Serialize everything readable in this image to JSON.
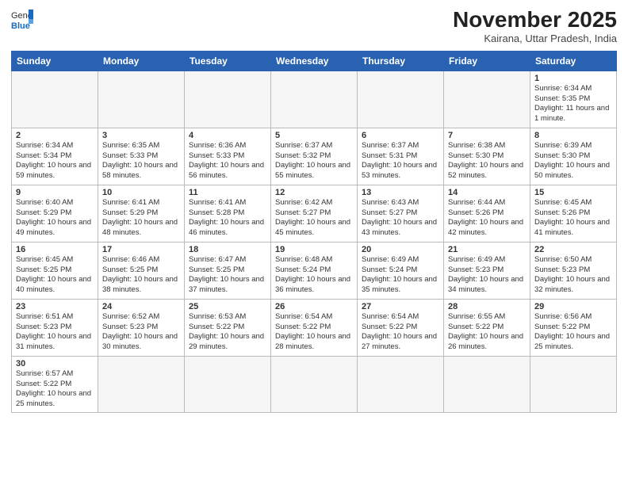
{
  "header": {
    "logo_general": "General",
    "logo_blue": "Blue",
    "month_title": "November 2025",
    "location": "Kairana, Uttar Pradesh, India"
  },
  "weekdays": [
    "Sunday",
    "Monday",
    "Tuesday",
    "Wednesday",
    "Thursday",
    "Friday",
    "Saturday"
  ],
  "weeks": [
    [
      {
        "day": "",
        "info": ""
      },
      {
        "day": "",
        "info": ""
      },
      {
        "day": "",
        "info": ""
      },
      {
        "day": "",
        "info": ""
      },
      {
        "day": "",
        "info": ""
      },
      {
        "day": "",
        "info": ""
      },
      {
        "day": "1",
        "info": "Sunrise: 6:34 AM\nSunset: 5:35 PM\nDaylight: 11 hours and 1 minute."
      }
    ],
    [
      {
        "day": "2",
        "info": "Sunrise: 6:34 AM\nSunset: 5:34 PM\nDaylight: 10 hours and 59 minutes."
      },
      {
        "day": "3",
        "info": "Sunrise: 6:35 AM\nSunset: 5:33 PM\nDaylight: 10 hours and 58 minutes."
      },
      {
        "day": "4",
        "info": "Sunrise: 6:36 AM\nSunset: 5:33 PM\nDaylight: 10 hours and 56 minutes."
      },
      {
        "day": "5",
        "info": "Sunrise: 6:37 AM\nSunset: 5:32 PM\nDaylight: 10 hours and 55 minutes."
      },
      {
        "day": "6",
        "info": "Sunrise: 6:37 AM\nSunset: 5:31 PM\nDaylight: 10 hours and 53 minutes."
      },
      {
        "day": "7",
        "info": "Sunrise: 6:38 AM\nSunset: 5:30 PM\nDaylight: 10 hours and 52 minutes."
      },
      {
        "day": "8",
        "info": "Sunrise: 6:39 AM\nSunset: 5:30 PM\nDaylight: 10 hours and 50 minutes."
      }
    ],
    [
      {
        "day": "9",
        "info": "Sunrise: 6:40 AM\nSunset: 5:29 PM\nDaylight: 10 hours and 49 minutes."
      },
      {
        "day": "10",
        "info": "Sunrise: 6:41 AM\nSunset: 5:29 PM\nDaylight: 10 hours and 48 minutes."
      },
      {
        "day": "11",
        "info": "Sunrise: 6:41 AM\nSunset: 5:28 PM\nDaylight: 10 hours and 46 minutes."
      },
      {
        "day": "12",
        "info": "Sunrise: 6:42 AM\nSunset: 5:27 PM\nDaylight: 10 hours and 45 minutes."
      },
      {
        "day": "13",
        "info": "Sunrise: 6:43 AM\nSunset: 5:27 PM\nDaylight: 10 hours and 43 minutes."
      },
      {
        "day": "14",
        "info": "Sunrise: 6:44 AM\nSunset: 5:26 PM\nDaylight: 10 hours and 42 minutes."
      },
      {
        "day": "15",
        "info": "Sunrise: 6:45 AM\nSunset: 5:26 PM\nDaylight: 10 hours and 41 minutes."
      }
    ],
    [
      {
        "day": "16",
        "info": "Sunrise: 6:45 AM\nSunset: 5:25 PM\nDaylight: 10 hours and 40 minutes."
      },
      {
        "day": "17",
        "info": "Sunrise: 6:46 AM\nSunset: 5:25 PM\nDaylight: 10 hours and 38 minutes."
      },
      {
        "day": "18",
        "info": "Sunrise: 6:47 AM\nSunset: 5:25 PM\nDaylight: 10 hours and 37 minutes."
      },
      {
        "day": "19",
        "info": "Sunrise: 6:48 AM\nSunset: 5:24 PM\nDaylight: 10 hours and 36 minutes."
      },
      {
        "day": "20",
        "info": "Sunrise: 6:49 AM\nSunset: 5:24 PM\nDaylight: 10 hours and 35 minutes."
      },
      {
        "day": "21",
        "info": "Sunrise: 6:49 AM\nSunset: 5:23 PM\nDaylight: 10 hours and 34 minutes."
      },
      {
        "day": "22",
        "info": "Sunrise: 6:50 AM\nSunset: 5:23 PM\nDaylight: 10 hours and 32 minutes."
      }
    ],
    [
      {
        "day": "23",
        "info": "Sunrise: 6:51 AM\nSunset: 5:23 PM\nDaylight: 10 hours and 31 minutes."
      },
      {
        "day": "24",
        "info": "Sunrise: 6:52 AM\nSunset: 5:23 PM\nDaylight: 10 hours and 30 minutes."
      },
      {
        "day": "25",
        "info": "Sunrise: 6:53 AM\nSunset: 5:22 PM\nDaylight: 10 hours and 29 minutes."
      },
      {
        "day": "26",
        "info": "Sunrise: 6:54 AM\nSunset: 5:22 PM\nDaylight: 10 hours and 28 minutes."
      },
      {
        "day": "27",
        "info": "Sunrise: 6:54 AM\nSunset: 5:22 PM\nDaylight: 10 hours and 27 minutes."
      },
      {
        "day": "28",
        "info": "Sunrise: 6:55 AM\nSunset: 5:22 PM\nDaylight: 10 hours and 26 minutes."
      },
      {
        "day": "29",
        "info": "Sunrise: 6:56 AM\nSunset: 5:22 PM\nDaylight: 10 hours and 25 minutes."
      }
    ],
    [
      {
        "day": "30",
        "info": "Sunrise: 6:57 AM\nSunset: 5:22 PM\nDaylight: 10 hours and 25 minutes."
      },
      {
        "day": "",
        "info": ""
      },
      {
        "day": "",
        "info": ""
      },
      {
        "day": "",
        "info": ""
      },
      {
        "day": "",
        "info": ""
      },
      {
        "day": "",
        "info": ""
      },
      {
        "day": "",
        "info": ""
      }
    ]
  ]
}
